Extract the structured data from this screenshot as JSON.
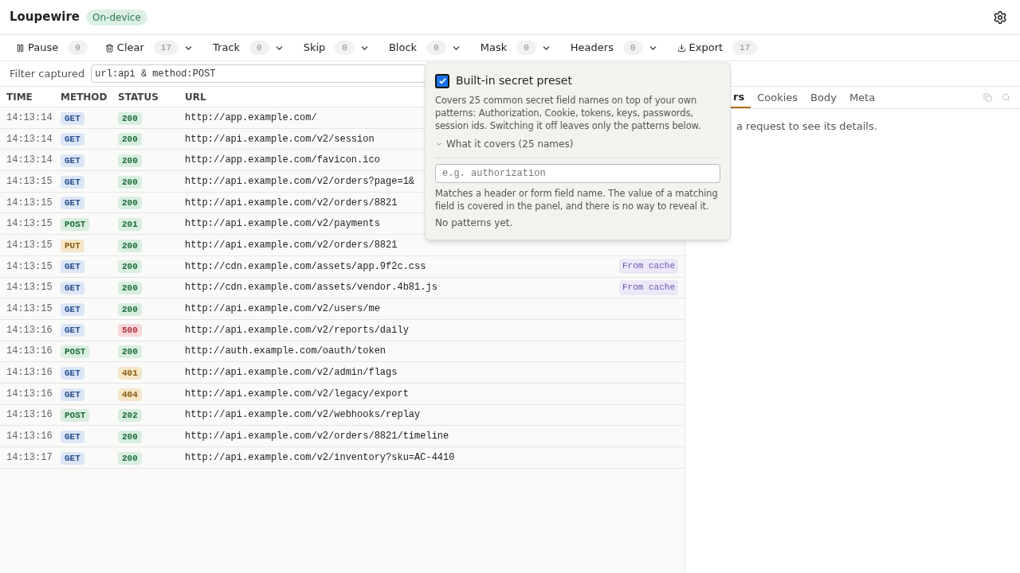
{
  "app": {
    "title": "Loupewire",
    "badge": "On-device"
  },
  "toolbar": [
    {
      "kind": "pause",
      "label": "Pause",
      "count": "0",
      "menu": false
    },
    {
      "kind": "trash",
      "label": "Clear",
      "count": "17",
      "menu": true
    },
    {
      "kind": "plain",
      "label": "Track",
      "count": "0",
      "menu": true
    },
    {
      "kind": "plain",
      "label": "Skip",
      "count": "0",
      "menu": true
    },
    {
      "kind": "plain",
      "label": "Block",
      "count": "0",
      "menu": true
    },
    {
      "kind": "plain",
      "label": "Mask",
      "count": "0",
      "menu": true
    },
    {
      "kind": "plain",
      "label": "Headers",
      "count": "0",
      "menu": true
    },
    {
      "kind": "download",
      "label": "Export",
      "count": "17",
      "menu": false
    }
  ],
  "filter": {
    "label": "Filter captured",
    "value": "url:api & method:POST"
  },
  "table": {
    "columns": [
      "TIME",
      "METHOD",
      "STATUS",
      "URL"
    ],
    "rows": [
      {
        "time": "14:13:14",
        "method": "GET",
        "status": "200",
        "url": "http://app.example.com/"
      },
      {
        "time": "14:13:14",
        "method": "GET",
        "status": "200",
        "url": "http://api.example.com/v2/session"
      },
      {
        "time": "14:13:14",
        "method": "GET",
        "status": "200",
        "url": "http://app.example.com/favicon.ico"
      },
      {
        "time": "14:13:15",
        "method": "GET",
        "status": "200",
        "url": "http://api.example.com/v2/orders?page=1&"
      },
      {
        "time": "14:13:15",
        "method": "GET",
        "status": "200",
        "url": "http://api.example.com/v2/orders/8821"
      },
      {
        "time": "14:13:15",
        "method": "POST",
        "status": "201",
        "url": "http://api.example.com/v2/payments"
      },
      {
        "time": "14:13:15",
        "method": "PUT",
        "status": "200",
        "url": "http://api.example.com/v2/orders/8821"
      },
      {
        "time": "14:13:15",
        "method": "GET",
        "status": "200",
        "url": "http://cdn.example.com/assets/app.9f2c.css",
        "tag": "From cache"
      },
      {
        "time": "14:13:15",
        "method": "GET",
        "status": "200",
        "url": "http://cdn.example.com/assets/vendor.4b81.js",
        "tag": "From cache"
      },
      {
        "time": "14:13:15",
        "method": "GET",
        "status": "200",
        "url": "http://api.example.com/v2/users/me"
      },
      {
        "time": "14:13:16",
        "method": "GET",
        "status": "500",
        "url": "http://api.example.com/v2/reports/daily"
      },
      {
        "time": "14:13:16",
        "method": "POST",
        "status": "200",
        "url": "http://auth.example.com/oauth/token"
      },
      {
        "time": "14:13:16",
        "method": "GET",
        "status": "401",
        "url": "http://api.example.com/v2/admin/flags"
      },
      {
        "time": "14:13:16",
        "method": "GET",
        "status": "404",
        "url": "http://api.example.com/v2/legacy/export"
      },
      {
        "time": "14:13:16",
        "method": "POST",
        "status": "202",
        "url": "http://api.example.com/v2/webhooks/replay"
      },
      {
        "time": "14:13:16",
        "method": "GET",
        "status": "200",
        "url": "http://api.example.com/v2/orders/8821/timeline"
      },
      {
        "time": "14:13:17",
        "method": "GET",
        "status": "200",
        "url": "http://api.example.com/v2/inventory?sku=AC-4410"
      }
    ]
  },
  "detail": {
    "tabs": [
      {
        "label": "rs",
        "selected": true
      },
      {
        "label": "Cookies",
        "selected": false
      },
      {
        "label": "Body",
        "selected": false
      },
      {
        "label": "Meta",
        "selected": false
      }
    ],
    "empty": "a request to see its details."
  },
  "popover": {
    "checkbox": {
      "label": "Built-in secret preset",
      "checked": true
    },
    "description": "Covers 25 common secret field names on top of your own patterns: Authorization, Cookie, tokens, keys, passwords, session ids. Switching it off leaves only the patterns below.",
    "disclosure": {
      "label": "What it covers (25 names)",
      "expanded": false
    },
    "input": {
      "placeholder": "e.g. authorization"
    },
    "hint": "Matches a header or form field name. The value of a matching field is covered in the panel, and there is no way to reveal it.",
    "empty": "No patterns yet."
  }
}
